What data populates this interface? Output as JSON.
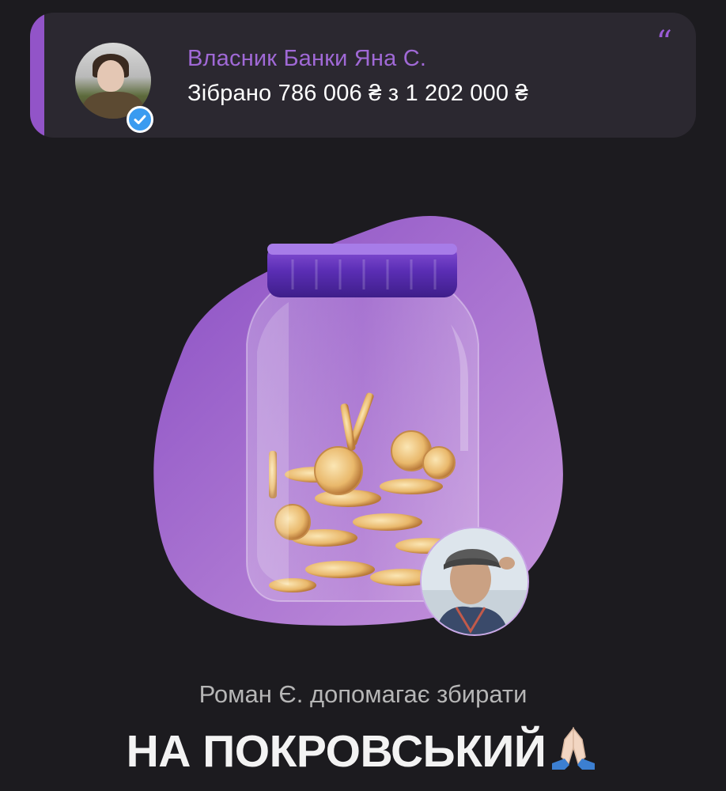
{
  "owner": {
    "name": "Власник Банки Яна С.",
    "collected": "Зібрано 786 006 ₴ з 1 202 000 ₴",
    "quote_icon": "quote-icon",
    "verified_icon": "verified-check-icon"
  },
  "jar": {
    "illustration": "coin-jar-icon"
  },
  "helper": {
    "caption": "Роман Є. допомагає збирати",
    "headline": "НА ПОКРОВСЬКИЙ",
    "emoji": "praying-hands-icon"
  },
  "colors": {
    "background": "#1c1b1f",
    "card": "#2b2830",
    "accent": "#9254c8",
    "owner_name": "#a069d6"
  }
}
